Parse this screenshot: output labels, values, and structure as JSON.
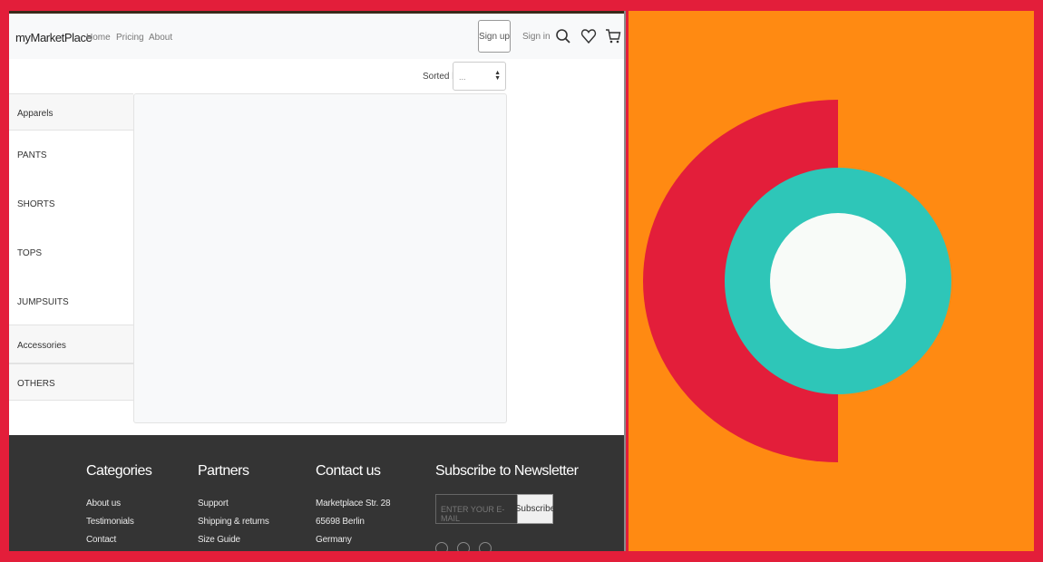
{
  "nav": {
    "brand": "myMarketPlace",
    "links": [
      "Home",
      "Pricing",
      "About"
    ],
    "signup": "Sign up",
    "signin": "Sign in",
    "icons": [
      "search-icon",
      "heart-icon",
      "cart-icon"
    ]
  },
  "sort": {
    "label": "Sorted by",
    "selected": "..."
  },
  "sidebar": {
    "apparels": "Apparels",
    "items": [
      "PANTS",
      "SHORTS",
      "TOPS",
      "JUMPSUITS"
    ],
    "accessories": "Accessories",
    "others": "OTHERS"
  },
  "footer": {
    "categories": {
      "title": "Categories",
      "links": [
        "About us",
        "Testimonials",
        "Contact"
      ]
    },
    "partners": {
      "title": "Partners",
      "links": [
        "Support",
        "Shipping & returns",
        "Size Guide"
      ]
    },
    "contact": {
      "title": "Contact us",
      "lines": [
        "Marketplace Str. 28",
        "65698 Berlin",
        "Germany"
      ]
    },
    "newsletter": {
      "title": "Subscribe to Newsletter",
      "placeholder": "ENTER YOUR E-MAIL",
      "button": "Subscribe"
    }
  },
  "colors": {
    "frame": "#e31e3a",
    "orange": "#ff8a12",
    "teal": "#2ec6b8",
    "red": "#e31e3a",
    "footer": "#343434"
  }
}
